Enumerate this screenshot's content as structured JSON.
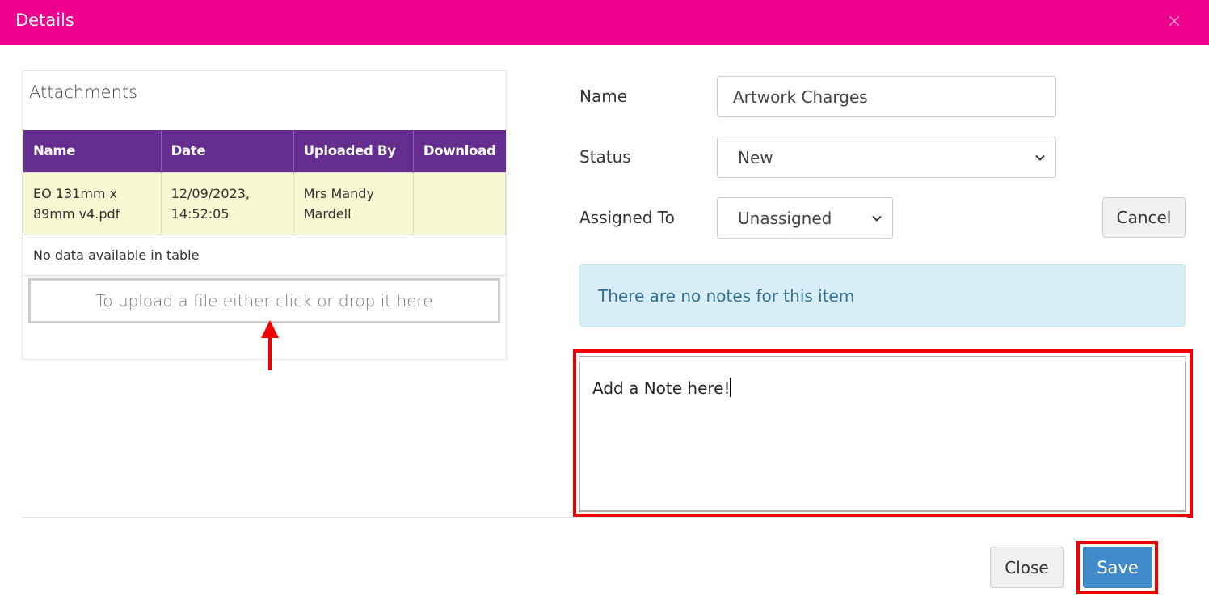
{
  "dialog": {
    "title": "Details",
    "close_glyph": "×"
  },
  "attachments": {
    "heading": "Attachments",
    "columns": [
      "Name",
      "Date",
      "Uploaded By",
      "Download"
    ],
    "rows": [
      {
        "name_line1": "EO 131mm x",
        "name_line2": "89mm v4.pdf",
        "date_line1": "12/09/2023,",
        "date_line2": "14:52:05",
        "uploaded_line1": "Mrs Mandy",
        "uploaded_line2": "Mardell",
        "download": ""
      }
    ],
    "empty_text": "No data available in table",
    "upload_text": "To upload a file either click or drop it here"
  },
  "form": {
    "name_label": "Name",
    "name_value": "Artwork Charges",
    "status_label": "Status",
    "status_value": "New",
    "assigned_label": "Assigned To",
    "assigned_value": "Unassigned",
    "cancel_label": "Cancel"
  },
  "notes": {
    "empty_message": "There are no notes for this item",
    "input_value": "Add a Note here!"
  },
  "footer": {
    "close_label": "Close",
    "save_label": "Save"
  },
  "colors": {
    "header": "#ec008c",
    "table_header": "#662d91",
    "row_highlight": "#f7f8d2",
    "info_bg": "#d9edf7",
    "primary": "#428bca",
    "annotation": "#ee0000"
  },
  "icons": [
    "close-icon",
    "chevron-down-icon",
    "arrow-up-icon"
  ]
}
